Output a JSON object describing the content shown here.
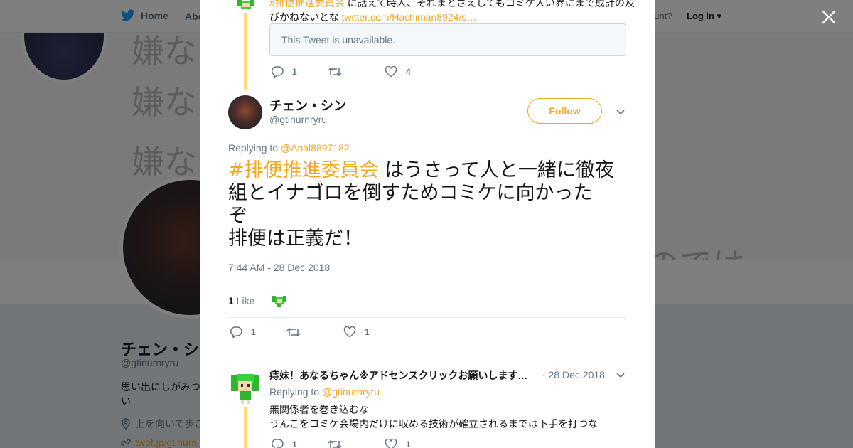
{
  "nav": {
    "home_label": "Home",
    "about_label": "Abo",
    "account_text": "ccount?",
    "login_label": "Log in"
  },
  "background": {
    "banner_lines": [
      "嫌な",
      "嫌な",
      "嫌な"
    ],
    "banner_right": "のでは",
    "profile_name": "チェン・シ",
    "profile_handle": "@gtinurnryru",
    "profile_bio": "思い出にしがみつい",
    "profile_location": "上を向いて歩こ",
    "profile_link": "twpf.jp/gtinurn"
  },
  "prev_tweet": {
    "text_tag": "#排便推進委員会",
    "text_line1_rest": " に話えて時人、それまとさえしてもコミケ人い界にまで成計の及",
    "text_line2": "びかねないとな ",
    "link": "twitter.com/Hachiman8924/s…",
    "unavailable": "This Tweet is unavailable.",
    "reply_count": "1",
    "like_count": "4"
  },
  "main_tweet": {
    "name": "チェン・シン",
    "handle": "@gtinurnryru",
    "follow_label": "Follow",
    "replying_prefix": "Replying to ",
    "replying_to": "@Anal8897182",
    "tag": "#排便推進委員会",
    "text_line1": " はうさって人と一緒に徹夜",
    "text_line2": "組とイナゴロを倒すためコミケに向かった",
    "text_line3": "ぞ",
    "text_line4": "排便は正義だ！",
    "timestamp": "7:44 AM - 28 Dec 2018",
    "likes_count": "1",
    "likes_label": " Like",
    "reply_count": "1",
    "like_count": "1"
  },
  "reply_tweet": {
    "name": "痔妹！あなるちゃん※アドセンスクリックお願いします…",
    "date": "· 28 Dec 2018",
    "replying_prefix": "Replying to ",
    "replying_to": "@gtinurnryru",
    "line1": "無関係者を巻き込むな",
    "line2": "うんこをコミケ会場内だけに収める技術が確立されるまでは下手を打つな",
    "reply_count": "1",
    "like_count": "1"
  },
  "colors": {
    "accent": "#f5a623",
    "thread_line": "#ffd97a",
    "muted": "#657786"
  }
}
